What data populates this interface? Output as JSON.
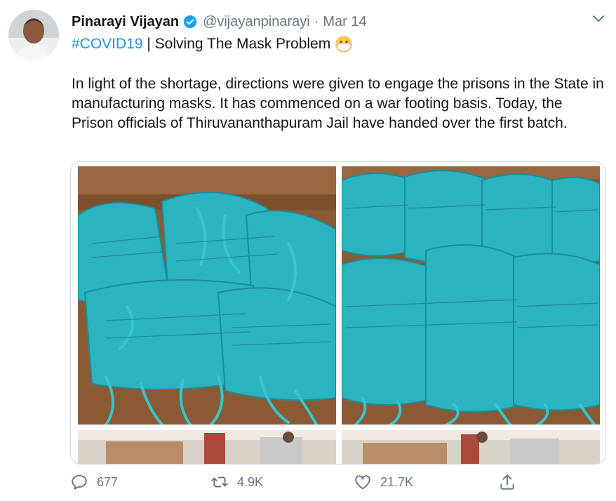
{
  "tweet": {
    "author_name": "Pinarayi Vijayan",
    "handle": "@vijayanpinarayi",
    "separator": "·",
    "date": "Mar 14",
    "hashtag": "#COVID19",
    "headline": " | Solving The Mask Problem",
    "body": "In light of the shortage, directions were given to engage the prisons in the State in manufacturing masks. It has commenced on a war footing basis. Today, the Prison officials of Thiruvananthapuram Jail have handed over the first batch."
  },
  "icons": {
    "verified": "verified-badge-icon",
    "caret": "chevron-down-icon",
    "mask_emoji": "face-with-medical-mask-emoji",
    "reply": "reply-icon",
    "retweet": "retweet-icon",
    "like": "heart-icon",
    "share": "share-icon"
  },
  "colors": {
    "link": "#1b95e0",
    "secondary_text": "#657786",
    "verified_blue": "#1da1f2",
    "mask_teal": "#2bb3c0"
  },
  "actions": {
    "reply_count": "677",
    "retweet_count": "4.9K",
    "like_count": "21.7K"
  }
}
